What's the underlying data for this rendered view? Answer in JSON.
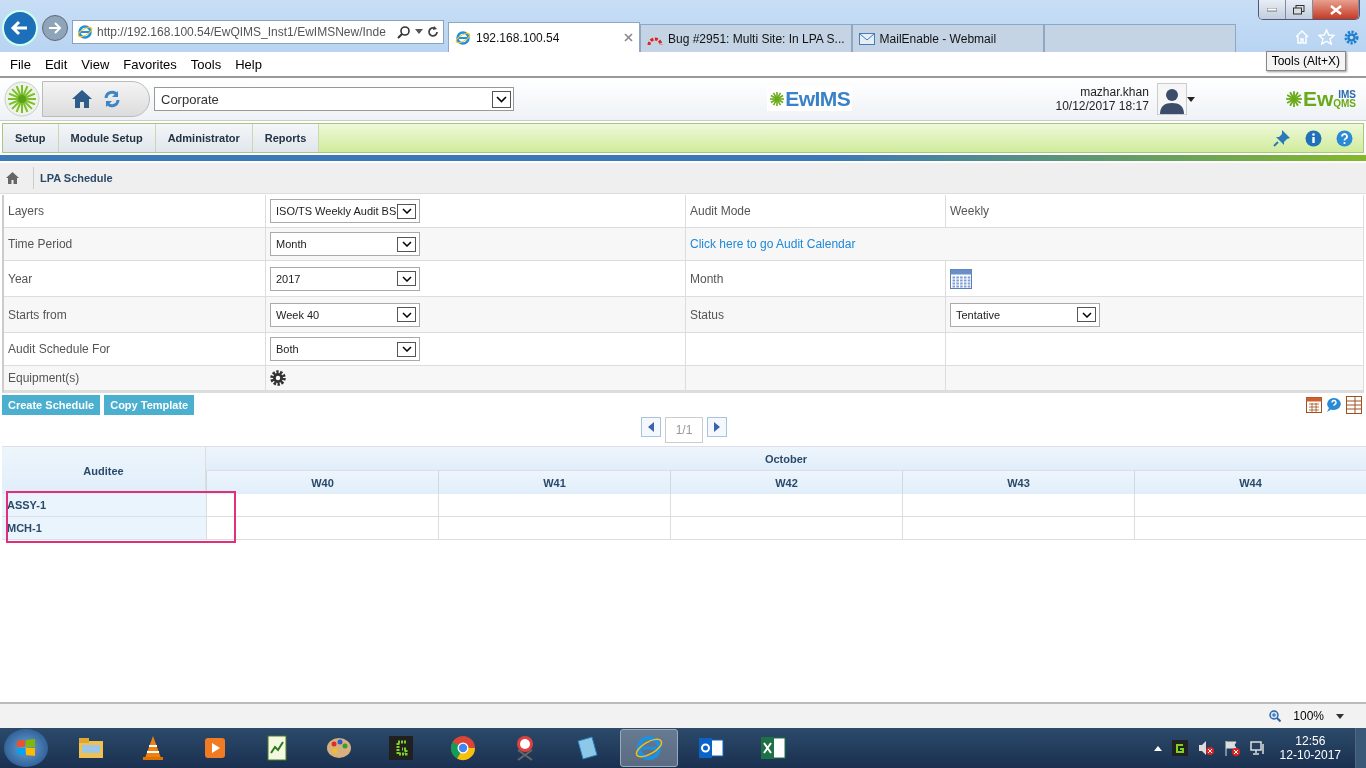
{
  "browser": {
    "address": "http://192.168.100.54/EwQIMS_Inst1/EwIMSNew/Inde",
    "tabs": [
      {
        "title": "192.168.100.54",
        "kind": "ie",
        "selected": true
      },
      {
        "title": "Bug #2951: Multi Site: In LPA S...",
        "kind": "bug",
        "selected": false
      },
      {
        "title": "MailEnable - Webmail",
        "kind": "mail",
        "selected": false
      }
    ],
    "tooltip": "Tools (Alt+X)",
    "menu": [
      "File",
      "Edit",
      "View",
      "Favorites",
      "Tools",
      "Help"
    ],
    "zoom": "100%"
  },
  "app": {
    "site": "Corporate",
    "logo": "EwIMS",
    "user": "mazhar.khan",
    "datetime": "10/12/2017 18:17",
    "brand": {
      "main": "Ew",
      "top": "IMS",
      "bottom": "QMS"
    },
    "nav": [
      "Setup",
      "Module Setup",
      "Administrator",
      "Reports"
    ]
  },
  "breadcrumb": "LPA Schedule",
  "form": {
    "rows": [
      {
        "cells": [
          {
            "kind": "label",
            "text": "Layers"
          },
          {
            "kind": "select",
            "text": "ISO/TS Weekly Audit BS"
          },
          {
            "kind": "label",
            "text": "Audit Mode"
          },
          {
            "kind": "text",
            "text": "Weekly"
          }
        ]
      },
      {
        "cells": [
          {
            "kind": "label",
            "text": "Time Period"
          },
          {
            "kind": "select",
            "text": "Month"
          },
          {
            "kind": "link",
            "text": "Click here to go Audit Calendar"
          }
        ]
      },
      {
        "cells": [
          {
            "kind": "label",
            "text": "Year"
          },
          {
            "kind": "select",
            "text": "2017"
          },
          {
            "kind": "label",
            "text": "Month"
          },
          {
            "kind": "calendar"
          }
        ]
      },
      {
        "cells": [
          {
            "kind": "label",
            "text": "Starts from"
          },
          {
            "kind": "select",
            "text": "Week 40"
          },
          {
            "kind": "label",
            "text": "Status"
          },
          {
            "kind": "select",
            "text": "Tentative"
          }
        ]
      },
      {
        "cells": [
          {
            "kind": "label",
            "text": "Audit Schedule For"
          },
          {
            "kind": "select",
            "text": "Both"
          },
          {
            "kind": "blank"
          },
          {
            "kind": "blank"
          }
        ]
      },
      {
        "cells": [
          {
            "kind": "label",
            "text": "Equipment(s)"
          },
          {
            "kind": "gear"
          },
          {
            "kind": "blank"
          },
          {
            "kind": "blank"
          }
        ]
      }
    ]
  },
  "actions": [
    "Create Schedule",
    "Copy Template"
  ],
  "pager": "1/1",
  "schedule": {
    "auditee_header": "Auditee",
    "month": "October",
    "weeks": [
      "W40",
      "W41",
      "W42",
      "W43",
      "W44"
    ],
    "rows": [
      {
        "name": "ASSY-1"
      },
      {
        "name": "MCH-1"
      }
    ],
    "highlighted": true
  },
  "taskbar": {
    "apps": [
      {
        "kind": "explorer",
        "selected": false
      },
      {
        "kind": "cone",
        "selected": false
      },
      {
        "kind": "player",
        "selected": false
      },
      {
        "kind": "notepad",
        "selected": false
      },
      {
        "kind": "paint",
        "selected": false
      },
      {
        "kind": "gnote",
        "selected": false
      },
      {
        "kind": "chrome",
        "selected": false
      },
      {
        "kind": "snip",
        "selected": false
      },
      {
        "kind": "book",
        "selected": false
      },
      {
        "kind": "ie",
        "selected": true
      },
      {
        "kind": "outlook",
        "selected": false
      },
      {
        "kind": "excel",
        "selected": false
      }
    ],
    "time": "12:56",
    "date": "12-10-2017"
  }
}
